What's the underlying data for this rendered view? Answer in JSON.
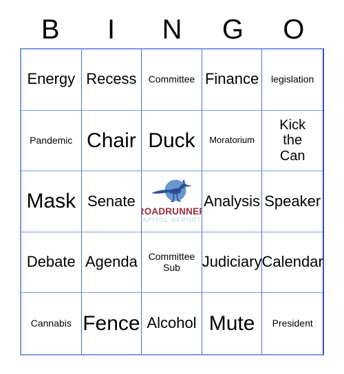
{
  "card": {
    "title": "BINGO",
    "header_letters": [
      "B",
      "I",
      "N",
      "G",
      "O"
    ],
    "colors": {
      "grid_line": "#4a6fd4",
      "grid_line_light": "#7b9ae0",
      "grid_border_right": "#2b50b4",
      "text": "#000000",
      "background": "#ffffff",
      "logo_circle": "#6699cc",
      "logo_bird": "#2f4f9e",
      "logo_wordmark": "#9e2a3c",
      "logo_subtext": "#cfe0f2"
    },
    "rows": [
      [
        {
          "label": "Energy",
          "size": "md"
        },
        {
          "label": "Recess",
          "size": "md"
        },
        {
          "label": "Committee",
          "size": "xs"
        },
        {
          "label": "Finance",
          "size": "md"
        },
        {
          "label": "legislation",
          "size": "xs"
        }
      ],
      [
        {
          "label": "Pandemic",
          "size": "xs"
        },
        {
          "label": "Chair",
          "size": "xl"
        },
        {
          "label": "Duck",
          "size": "xl"
        },
        {
          "label": "Moratorium",
          "size": "xxs"
        },
        {
          "label": "Kick\nthe\nCan",
          "size": "sm"
        }
      ],
      [
        {
          "label": "Mask",
          "size": "xl"
        },
        {
          "label": "Senate",
          "size": "md"
        },
        {
          "label": "",
          "size": "md",
          "is_logo": true
        },
        {
          "label": "Analysis",
          "size": "md"
        },
        {
          "label": "Speaker",
          "size": "md"
        }
      ],
      [
        {
          "label": "Debate",
          "size": "md"
        },
        {
          "label": "Agenda",
          "size": "md"
        },
        {
          "label": "Committee\nSub",
          "size": "xs"
        },
        {
          "label": "Judiciary",
          "size": "md"
        },
        {
          "label": "Calendar",
          "size": "md"
        }
      ],
      [
        {
          "label": "Cannabis",
          "size": "xs"
        },
        {
          "label": "Fence",
          "size": "xl"
        },
        {
          "label": "Alcohol",
          "size": "md"
        },
        {
          "label": "Mute",
          "size": "xl"
        },
        {
          "label": "President",
          "size": "xs"
        }
      ]
    ],
    "free_space": {
      "logo_name": "roadrunner-capitol-reports-logo",
      "wordmark": "ROADRUNNER",
      "subtext": "CAPITOL REPORTS",
      "icon_name": "roadrunner-bird-icon"
    }
  }
}
